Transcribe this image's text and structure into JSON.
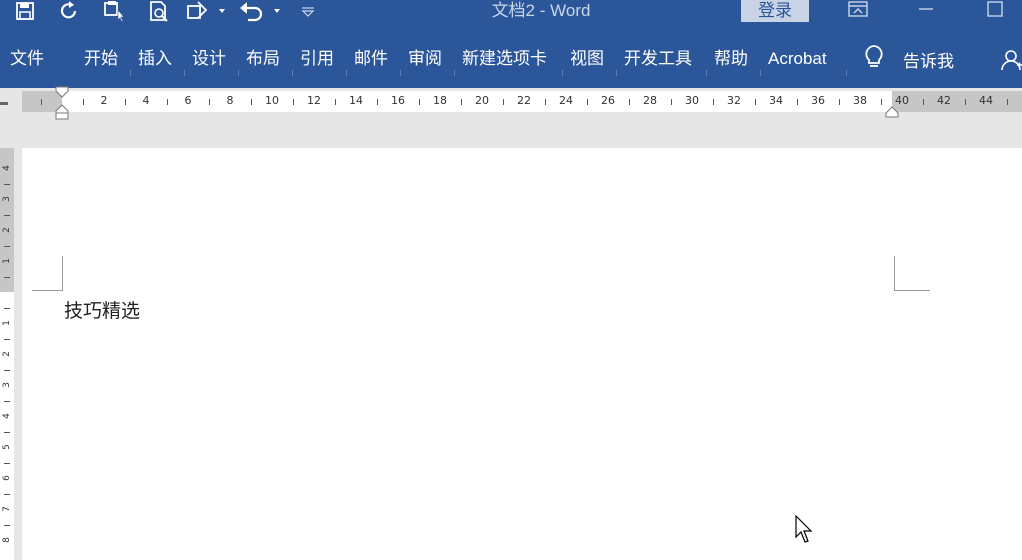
{
  "window": {
    "title": "文档2  -  Word",
    "login_label": "登录"
  },
  "qat": {
    "icons": [
      "save-icon",
      "redo-icon",
      "touch-mode-icon",
      "print-preview-icon",
      "shapes-icon",
      "undo-icon",
      "customize-qat-icon"
    ]
  },
  "ribbon": {
    "tabs": [
      {
        "label": "文件"
      },
      {
        "label": "开始"
      },
      {
        "label": "插入"
      },
      {
        "label": "设计"
      },
      {
        "label": "布局"
      },
      {
        "label": "引用"
      },
      {
        "label": "邮件"
      },
      {
        "label": "审阅"
      },
      {
        "label": "新建选项卡"
      },
      {
        "label": "视图"
      },
      {
        "label": "开发工具"
      },
      {
        "label": "帮助"
      },
      {
        "label": "Acrobat"
      }
    ],
    "tell_me_label": "告诉我"
  },
  "ruler": {
    "horizontal_labels": [
      "2",
      "4",
      "6",
      "8",
      "10",
      "12",
      "14",
      "16",
      "18",
      "20",
      "22",
      "24",
      "26",
      "28",
      "30",
      "32",
      "34",
      "36",
      "38",
      "40",
      "42",
      "44"
    ],
    "vertical_labels_top": [
      "4",
      "3",
      "2",
      "1"
    ],
    "vertical_labels_bottom": [
      "1",
      "2",
      "3",
      "4",
      "5",
      "6",
      "7",
      "8"
    ]
  },
  "document": {
    "text": "技巧精选"
  },
  "colors": {
    "ribbon_blue": "#2b579a",
    "page_background": "#e6e6e6"
  }
}
